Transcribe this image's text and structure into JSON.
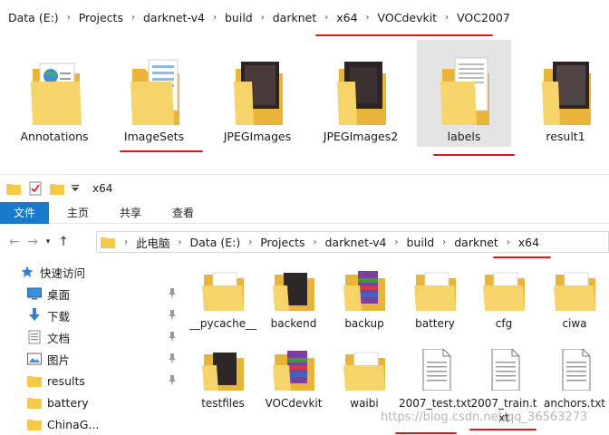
{
  "top_window": {
    "breadcrumb": [
      "Data (E:)",
      "Projects",
      "darknet-v4",
      "build",
      "darknet",
      "x64",
      "VOCdevkit",
      "VOC2007"
    ],
    "items": [
      {
        "label": "Annotations",
        "type": "annotations"
      },
      {
        "label": "ImageSets",
        "type": "imagesets"
      },
      {
        "label": "JPEGImages",
        "type": "photos"
      },
      {
        "label": "JPEGImages2",
        "type": "photos"
      },
      {
        "label": "labels",
        "type": "labels",
        "selected": true
      },
      {
        "label": "result1",
        "type": "photos"
      }
    ]
  },
  "bottom_window": {
    "title": "x64",
    "ribbon_tabs": [
      "文件",
      "主页",
      "共享",
      "查看"
    ],
    "address": [
      "此电脑",
      "Data (E:)",
      "Projects",
      "darknet-v4",
      "build",
      "darknet",
      "x64"
    ],
    "nav_items": [
      {
        "label": "快速访问",
        "icon": "star-icon"
      },
      {
        "label": "桌面",
        "icon": "desktop-icon",
        "pinned": true
      },
      {
        "label": "下载",
        "icon": "download-icon",
        "pinned": true
      },
      {
        "label": "文档",
        "icon": "document-icon",
        "pinned": true
      },
      {
        "label": "图片",
        "icon": "picture-icon",
        "pinned": true
      },
      {
        "label": "results",
        "icon": "folder-icon",
        "pinned": true
      },
      {
        "label": "battery",
        "icon": "folder-icon"
      },
      {
        "label": "ChinaG...",
        "icon": "folder-icon"
      }
    ],
    "files": [
      {
        "label": "__pycache__",
        "type": "folder"
      },
      {
        "label": "backend",
        "type": "folder-dark"
      },
      {
        "label": "backup",
        "type": "folder-rar"
      },
      {
        "label": "battery",
        "type": "folder"
      },
      {
        "label": "cfg",
        "type": "folder"
      },
      {
        "label": "ciwa",
        "type": "folder"
      },
      {
        "label": "testfiles",
        "type": "folder-dark"
      },
      {
        "label": "VOCdevkit",
        "type": "folder-rar"
      },
      {
        "label": "waibi",
        "type": "folder"
      },
      {
        "label": "2007_test.txt",
        "type": "txt"
      },
      {
        "label": "2007_train.txt",
        "type": "txt"
      },
      {
        "label": "anchors.txt",
        "type": "txt"
      }
    ]
  },
  "watermark": "https://blog.csdn.net/qq_36563273",
  "colors": {
    "accent": "#1979ca",
    "folder": "#f5c94c",
    "annotation": "#e1141b",
    "selection": "#e4e4e4"
  }
}
